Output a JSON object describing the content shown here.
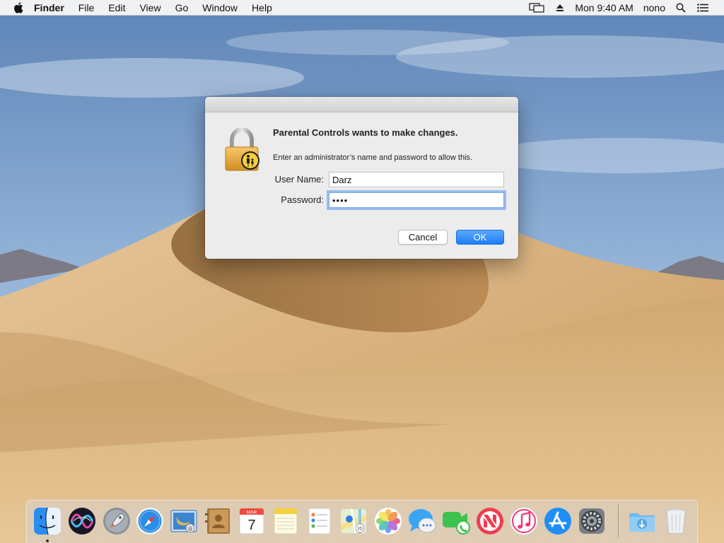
{
  "menubar": {
    "app_name": "Finder",
    "menus": [
      "File",
      "Edit",
      "View",
      "Go",
      "Window",
      "Help"
    ],
    "clock": "Mon 9:40 AM",
    "user": "nono",
    "status_icons": [
      "display-mirroring-icon",
      "eject-icon",
      "spotlight-search-icon",
      "notification-center-icon"
    ]
  },
  "dialog": {
    "title": "Parental Controls wants to make changes.",
    "message": "Enter an administrator’s name and password to allow this.",
    "username_label": "User Name:",
    "username_value": "Darz",
    "password_label": "Password:",
    "password_value": "••••",
    "cancel_label": "Cancel",
    "ok_label": "OK",
    "accent_color": "#1d7ef8"
  },
  "dock": {
    "apps": [
      {
        "name": "Finder",
        "icon": "finder-icon",
        "running": true
      },
      {
        "name": "Siri",
        "icon": "siri-icon"
      },
      {
        "name": "Launchpad",
        "icon": "launchpad-icon"
      },
      {
        "name": "Safari",
        "icon": "safari-icon"
      },
      {
        "name": "Mail",
        "icon": "mail-icon"
      },
      {
        "name": "Contacts",
        "icon": "contacts-icon"
      },
      {
        "name": "Calendar",
        "icon": "calendar-icon",
        "month": "MAR",
        "day": "7"
      },
      {
        "name": "Notes",
        "icon": "notes-icon"
      },
      {
        "name": "Reminders",
        "icon": "reminders-icon"
      },
      {
        "name": "Maps",
        "icon": "maps-icon"
      },
      {
        "name": "Photos",
        "icon": "photos-icon"
      },
      {
        "name": "Messages",
        "icon": "messages-icon"
      },
      {
        "name": "FaceTime",
        "icon": "facetime-icon"
      },
      {
        "name": "News",
        "icon": "news-icon"
      },
      {
        "name": "iTunes",
        "icon": "itunes-icon"
      },
      {
        "name": "App Store",
        "icon": "app-store-icon"
      },
      {
        "name": "System Preferences",
        "icon": "system-preferences-icon"
      },
      {
        "name": "Downloads",
        "icon": "downloads-folder-icon"
      },
      {
        "name": "Trash",
        "icon": "trash-icon"
      }
    ]
  }
}
